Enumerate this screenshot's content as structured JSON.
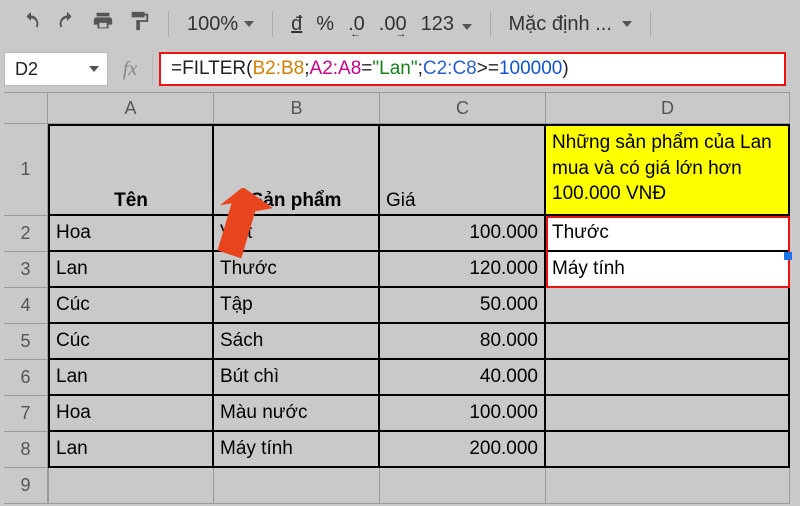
{
  "toolbar": {
    "zoom": "100%",
    "currency": "đ",
    "percent": "%",
    "dec_less": ".0",
    "dec_more": ".00",
    "num_123": "123",
    "font_name": "Mặc định ..."
  },
  "namebox": "D2",
  "formula": {
    "eq": "=",
    "fn": "FILTER",
    "open": "(",
    "ref1": "B2:B8",
    "sep1": ";",
    "ref2": "A2:A8",
    "eq2": "=",
    "str": "\"Lan\"",
    "sep2": ";",
    "ref3": "C2:C8",
    "gte": ">=",
    "num": "100000",
    "close": ")"
  },
  "colHeaders": [
    "A",
    "B",
    "C",
    "D"
  ],
  "rowHeaders": [
    "1",
    "2",
    "3",
    "4",
    "5",
    "6",
    "7",
    "8",
    "9"
  ],
  "headers": {
    "A": "Tên",
    "B": "Sản phẩm",
    "C": "Giá",
    "D": "Những sản phẩm của Lan mua và có giá lớn hơn 100.000 VNĐ"
  },
  "rows": [
    {
      "A": "Hoa",
      "B": "Viết",
      "C": "100.000"
    },
    {
      "A": "Lan",
      "B": "Thước",
      "C": "120.000"
    },
    {
      "A": "Cúc",
      "B": "Tập",
      "C": "50.000"
    },
    {
      "A": "Cúc",
      "B": "Sách",
      "C": "80.000"
    },
    {
      "A": "Lan",
      "B": "Bút chì",
      "C": "40.000"
    },
    {
      "A": "Hoa",
      "B": "Màu nước",
      "C": "100.000"
    },
    {
      "A": "Lan",
      "B": "Máy tính",
      "C": "200.000"
    }
  ],
  "results": [
    "Thước",
    "Máy tính"
  ]
}
